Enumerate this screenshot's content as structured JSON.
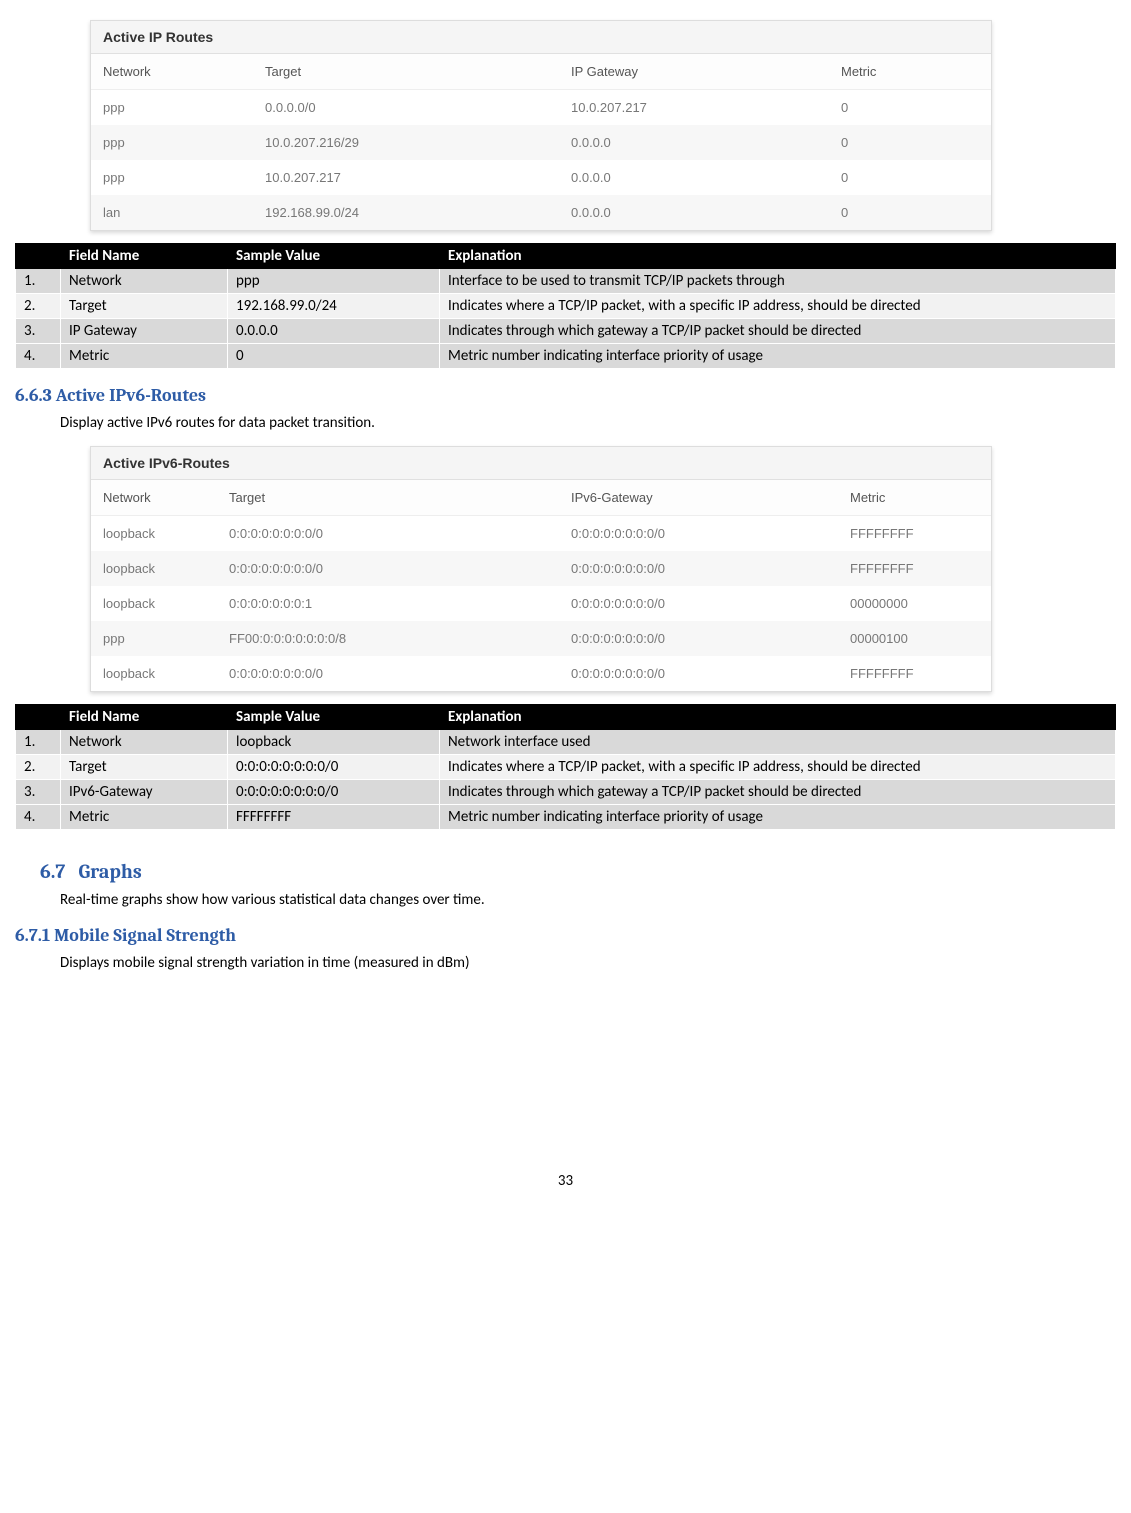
{
  "ipv4": {
    "panel_title": "Active IP Routes",
    "headers": [
      "Network",
      "Target",
      "IP Gateway",
      "Metric"
    ],
    "rows": [
      {
        "c0": "ppp",
        "c1": "0.0.0.0/0",
        "c2": "10.0.207.217",
        "c3": "0"
      },
      {
        "c0": "ppp",
        "c1": "10.0.207.216/29",
        "c2": "0.0.0.0",
        "c3": "0"
      },
      {
        "c0": "ppp",
        "c1": "10.0.207.217",
        "c2": "0.0.0.0",
        "c3": "0"
      },
      {
        "c0": "lan",
        "c1": "192.168.99.0/24",
        "c2": "0.0.0.0",
        "c3": "0"
      }
    ]
  },
  "ipv4_fields": {
    "headers": {
      "num": "",
      "name": "Field Name",
      "sample": "Sample Value",
      "expl": "Explanation"
    },
    "rows": [
      {
        "num": "1.",
        "name": "Network",
        "sample": "ppp",
        "expl": "Interface to be used to transmit TCP/IP packets through"
      },
      {
        "num": "2.",
        "name": "Target",
        "sample": "192.168.99.0/24",
        "expl": "Indicates where a TCP/IP packet, with a specific IP address, should be directed"
      },
      {
        "num": "3.",
        "name": "IP Gateway",
        "sample": "0.0.0.0",
        "expl": "Indicates through which gateway a TCP/IP packet should be directed"
      },
      {
        "num": "4.",
        "name": "Metric",
        "sample": "0",
        "expl": "Metric number indicating interface priority of usage"
      }
    ]
  },
  "sec663": {
    "num": "6.6.3",
    "title": "Active IPv6-Routes",
    "text": "Display active IPv6 routes for data packet transition."
  },
  "ipv6": {
    "panel_title": "Active IPv6-Routes",
    "headers": [
      "Network",
      "Target",
      "IPv6-Gateway",
      "Metric"
    ],
    "rows": [
      {
        "c0": "loopback",
        "c1": "0:0:0:0:0:0:0:0/0",
        "c2": "0:0:0:0:0:0:0:0/0",
        "c3": "FFFFFFFF"
      },
      {
        "c0": "loopback",
        "c1": "0:0:0:0:0:0:0:0/0",
        "c2": "0:0:0:0:0:0:0:0/0",
        "c3": "FFFFFFFF"
      },
      {
        "c0": "loopback",
        "c1": "0:0:0:0:0:0:0:1",
        "c2": "0:0:0:0:0:0:0:0/0",
        "c3": "00000000"
      },
      {
        "c0": "ppp",
        "c1": "FF00:0:0:0:0:0:0:0/8",
        "c2": "0:0:0:0:0:0:0:0/0",
        "c3": "00000100"
      },
      {
        "c0": "loopback",
        "c1": "0:0:0:0:0:0:0:0/0",
        "c2": "0:0:0:0:0:0:0:0/0",
        "c3": "FFFFFFFF"
      }
    ]
  },
  "ipv6_fields": {
    "headers": {
      "num": "",
      "name": "Field Name",
      "sample": "Sample Value",
      "expl": "Explanation"
    },
    "rows": [
      {
        "num": "1.",
        "name": "Network",
        "sample": "loopback",
        "expl": "Network interface used"
      },
      {
        "num": "2.",
        "name": "Target",
        "sample": "0:0:0:0:0:0:0:0/0",
        "expl": "Indicates where a TCP/IP packet, with a specific IP address, should be directed"
      },
      {
        "num": "3.",
        "name": "IPv6-Gateway",
        "sample": "0:0:0:0:0:0:0:0/0",
        "expl": "Indicates through which gateway a TCP/IP packet should be directed"
      },
      {
        "num": "4.",
        "name": "Metric",
        "sample": "FFFFFFFF",
        "expl": "Metric number indicating interface priority of usage"
      }
    ]
  },
  "sec67": {
    "num": "6.7",
    "title": "Graphs",
    "text": "Real-time graphs show how various statistical data changes over time."
  },
  "sec671": {
    "num": "6.7.1",
    "title": "Mobile Signal Strength",
    "text": "Displays mobile signal strength variation in time (measured in dBm)"
  },
  "page_number": "33"
}
